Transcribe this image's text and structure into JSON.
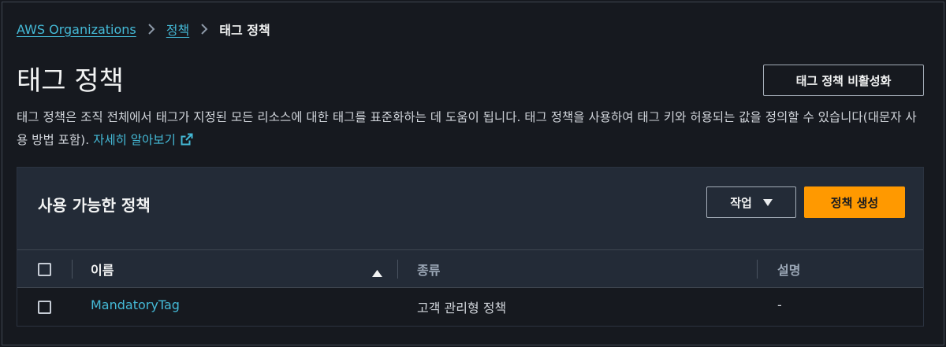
{
  "breadcrumb": {
    "items": [
      "AWS Organizations",
      "정책"
    ],
    "current": "태그 정책"
  },
  "header": {
    "title": "태그 정책",
    "disable_button": "태그 정책 비활성화"
  },
  "description": {
    "text": "태그 정책은 조직 전체에서 태그가 지정된 모든 리소스에 대한 태그를 표준화하는 데 도움이 됩니다. 태그 정책을 사용하여 태그 키와 허용되는 값을 정의할 수 있습니다(대문자 사용 방법 포함).",
    "learn_more": "자세히 알아보기",
    "icons": [
      "external-link-icon"
    ]
  },
  "panel": {
    "title": "사용 가능한 정책",
    "actions_button": "작업",
    "create_button": "정책 생성",
    "table": {
      "columns": [
        "이름",
        "종류",
        "설명"
      ],
      "rows": [
        {
          "name": "MandatoryTag",
          "type": "고객 관리형 정책",
          "description": "-"
        }
      ]
    }
  },
  "colors": {
    "background": "#16191f",
    "panel": "#232b37",
    "link": "#44b9d6",
    "primary_button": "#ff9900"
  }
}
